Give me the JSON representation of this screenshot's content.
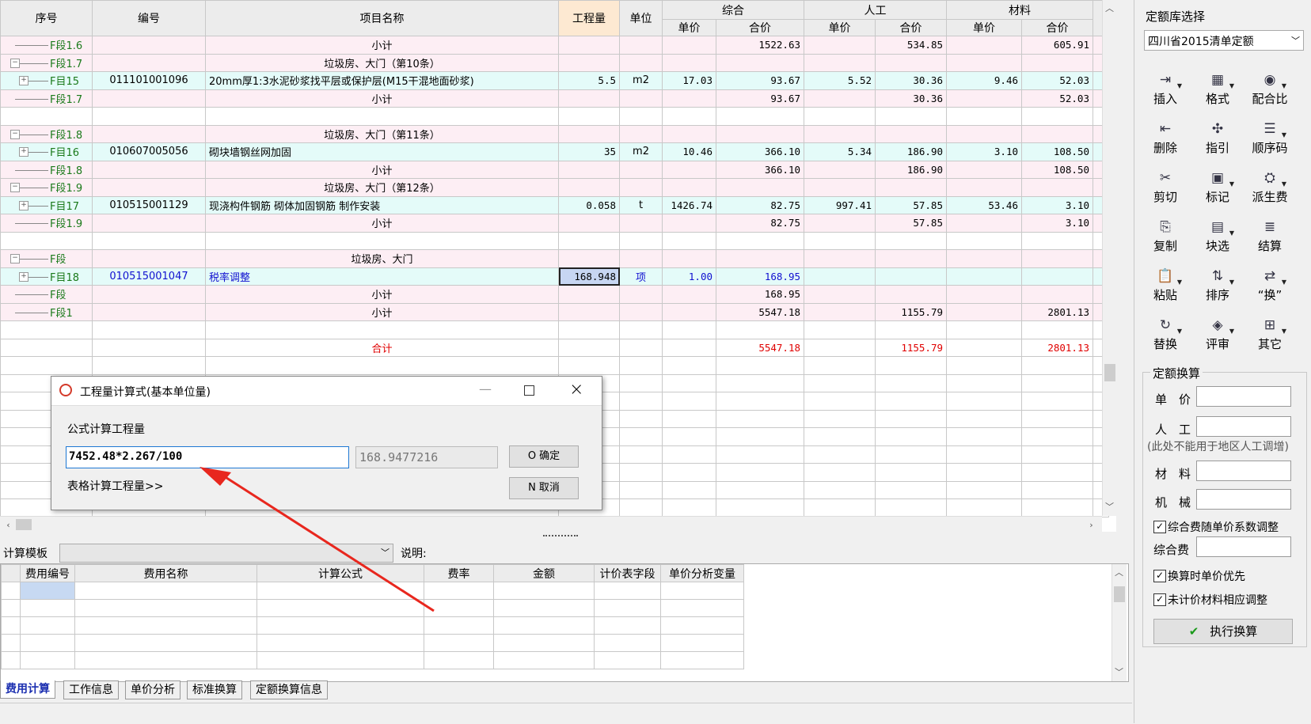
{
  "header": {
    "xuhao": "序号",
    "bianhao": "编号",
    "xmmc": "项目名称",
    "gcl": "工程量",
    "danwei": "单位",
    "zonghe": "综合",
    "rengong": "人工",
    "cailiao": "材料",
    "danjia": "单价",
    "hejia": "合价"
  },
  "rows": [
    {
      "type": "seg",
      "tree": "F段1.6",
      "bh": "",
      "name": "小计",
      "qty": "",
      "unit": "",
      "zd": "",
      "zh": "1522.63",
      "rd": "",
      "rh": "534.85",
      "cd": "",
      "ch": "605.91"
    },
    {
      "type": "seg",
      "tree": "F段1.7",
      "bh": "",
      "name": "垃圾房、大门（第10条）",
      "qty": "",
      "unit": "",
      "zd": "",
      "zh": "",
      "rd": "",
      "rh": "",
      "cd": "",
      "ch": ""
    },
    {
      "type": "item",
      "tree": "F目15",
      "bh": "011101001096",
      "name": "20mm厚1:3水泥砂浆找平层或保护层(M15干混地面砂浆)",
      "qty": "5.5",
      "unit": "m2",
      "zd": "17.03",
      "zh": "93.67",
      "rd": "5.52",
      "rh": "30.36",
      "cd": "9.46",
      "ch": "52.03"
    },
    {
      "type": "seg",
      "tree": "F段1.7",
      "bh": "",
      "name": "小计",
      "qty": "",
      "unit": "",
      "zd": "",
      "zh": "93.67",
      "rd": "",
      "rh": "30.36",
      "cd": "",
      "ch": "52.03"
    },
    {
      "type": "blank",
      "tree": "",
      "bh": "",
      "name": "",
      "qty": "",
      "unit": "",
      "zd": "",
      "zh": "",
      "rd": "",
      "rh": "",
      "cd": "",
      "ch": ""
    },
    {
      "type": "seg",
      "tree": "F段1.8",
      "bh": "",
      "name": "垃圾房、大门（第11条）",
      "qty": "",
      "unit": "",
      "zd": "",
      "zh": "",
      "rd": "",
      "rh": "",
      "cd": "",
      "ch": ""
    },
    {
      "type": "item",
      "tree": "F目16",
      "bh": "010607005056",
      "name": "砌块墙钢丝网加固",
      "qty": "35",
      "unit": "m2",
      "zd": "10.46",
      "zh": "366.10",
      "rd": "5.34",
      "rh": "186.90",
      "cd": "3.10",
      "ch": "108.50"
    },
    {
      "type": "seg",
      "tree": "F段1.8",
      "bh": "",
      "name": "小计",
      "qty": "",
      "unit": "",
      "zd": "",
      "zh": "366.10",
      "rd": "",
      "rh": "186.90",
      "cd": "",
      "ch": "108.50"
    },
    {
      "type": "seg",
      "tree": "F段1.9",
      "bh": "",
      "name": "垃圾房、大门（第12条）",
      "qty": "",
      "unit": "",
      "zd": "",
      "zh": "",
      "rd": "",
      "rh": "",
      "cd": "",
      "ch": ""
    },
    {
      "type": "item",
      "tree": "F目17",
      "bh": "010515001129",
      "name": "现浇构件钢筋 砌体加固钢筋 制作安装",
      "qty": "0.058",
      "unit": "t",
      "zd": "1426.74",
      "zh": "82.75",
      "rd": "997.41",
      "rh": "57.85",
      "cd": "53.46",
      "ch": "3.10"
    },
    {
      "type": "seg",
      "tree": "F段1.9",
      "bh": "",
      "name": "小计",
      "qty": "",
      "unit": "",
      "zd": "",
      "zh": "82.75",
      "rd": "",
      "rh": "57.85",
      "cd": "",
      "ch": "3.10"
    },
    {
      "type": "blank",
      "tree": "",
      "bh": "",
      "name": "",
      "qty": "",
      "unit": "",
      "zd": "",
      "zh": "",
      "rd": "",
      "rh": "",
      "cd": "",
      "ch": ""
    },
    {
      "type": "seg",
      "tree": "F段",
      "bh": "",
      "name": "垃圾房、大门",
      "qty": "",
      "unit": "",
      "zd": "",
      "zh": "",
      "rd": "",
      "rh": "",
      "cd": "",
      "ch": ""
    },
    {
      "type": "item",
      "tree": "F目18",
      "bh": "010515001047",
      "name": "税率调整",
      "qty": "168.948",
      "unit": "项",
      "zd": "1.00",
      "zh": "168.95",
      "rd": "",
      "rh": "",
      "cd": "",
      "ch": "",
      "blue": true,
      "sel": true
    },
    {
      "type": "seg",
      "tree": "F段",
      "bh": "",
      "name": "小计",
      "qty": "",
      "unit": "",
      "zd": "",
      "zh": "168.95",
      "rd": "",
      "rh": "",
      "cd": "",
      "ch": ""
    },
    {
      "type": "seg",
      "tree": "F段1",
      "bh": "",
      "name": "小计",
      "qty": "",
      "unit": "",
      "zd": "",
      "zh": "5547.18",
      "rd": "",
      "rh": "1155.79",
      "cd": "",
      "ch": "2801.13"
    },
    {
      "type": "blank",
      "tree": "",
      "bh": "",
      "name": "",
      "qty": "",
      "unit": "",
      "zd": "",
      "zh": "",
      "rd": "",
      "rh": "",
      "cd": "",
      "ch": ""
    },
    {
      "type": "total",
      "tree": "",
      "bh": "",
      "name": "合计",
      "qty": "",
      "unit": "",
      "zd": "",
      "zh": "5547.18",
      "rd": "",
      "rh": "1155.79",
      "cd": "",
      "ch": "2801.13"
    }
  ],
  "dialog": {
    "title": "工程量计算式(基本单位量)",
    "label": "公式计算工程量",
    "formula": "7452.48*2.267/100",
    "result": "168.9477216",
    "ok": "O 确定",
    "cancel": "N 取消",
    "table_link": "表格计算工程量>>"
  },
  "bottom": {
    "template_label": "计算模板",
    "desc_label": "说明:",
    "cols": [
      "费用编号",
      "费用名称",
      "计算公式",
      "费率",
      "金额",
      "计价表字段",
      "单价分析变量"
    ]
  },
  "tabs": [
    "费用计算",
    "工作信息",
    "单价分析",
    "标准换算",
    "定额换算信息"
  ],
  "right": {
    "lib_label": "定额库选择",
    "lib_value": "四川省2015清单定额",
    "tools": [
      {
        "label": "插入",
        "icon": "insert-icon",
        "glyph": "⇥"
      },
      {
        "label": "格式",
        "icon": "format-icon",
        "glyph": "▦"
      },
      {
        "label": "配合比",
        "icon": "mix-ratio-icon",
        "glyph": "◉"
      },
      {
        "label": "删除",
        "icon": "delete-icon",
        "glyph": "⇤"
      },
      {
        "label": "指引",
        "icon": "guide-icon",
        "glyph": "✣"
      },
      {
        "label": "顺序码",
        "icon": "sequence-icon",
        "glyph": "☰"
      },
      {
        "label": "剪切",
        "icon": "cut-icon",
        "glyph": "✂"
      },
      {
        "label": "标记",
        "icon": "mark-icon",
        "glyph": "▣"
      },
      {
        "label": "派生费",
        "icon": "derive-icon",
        "glyph": "⛭"
      },
      {
        "label": "复制",
        "icon": "copy-icon",
        "glyph": "⎘"
      },
      {
        "label": "块选",
        "icon": "block-select-icon",
        "glyph": "▤"
      },
      {
        "label": "结算",
        "icon": "settle-icon",
        "glyph": "≣"
      },
      {
        "label": "粘贴",
        "icon": "paste-icon",
        "glyph": "📋"
      },
      {
        "label": "排序",
        "icon": "sort-icon",
        "glyph": "⇅"
      },
      {
        "label": "“换”",
        "icon": "swap-icon",
        "glyph": "⇄"
      },
      {
        "label": "替换",
        "icon": "replace-icon",
        "glyph": "↻"
      },
      {
        "label": "评审",
        "icon": "review-icon",
        "glyph": "◈"
      },
      {
        "label": "其它",
        "icon": "other-icon",
        "glyph": "⊞"
      }
    ],
    "group_title": "定额换算",
    "unit_price": "单　价",
    "labor": "人　工",
    "labor_note": "(此处不能用于地区人工调增)",
    "material": "材　料",
    "machine": "机　械",
    "cb1": "综合费随单价系数调整",
    "comp_fee": "综合费",
    "cb2": "换算时单价优先",
    "cb3": "未计价材料相应调整",
    "exec": "执行换算"
  }
}
